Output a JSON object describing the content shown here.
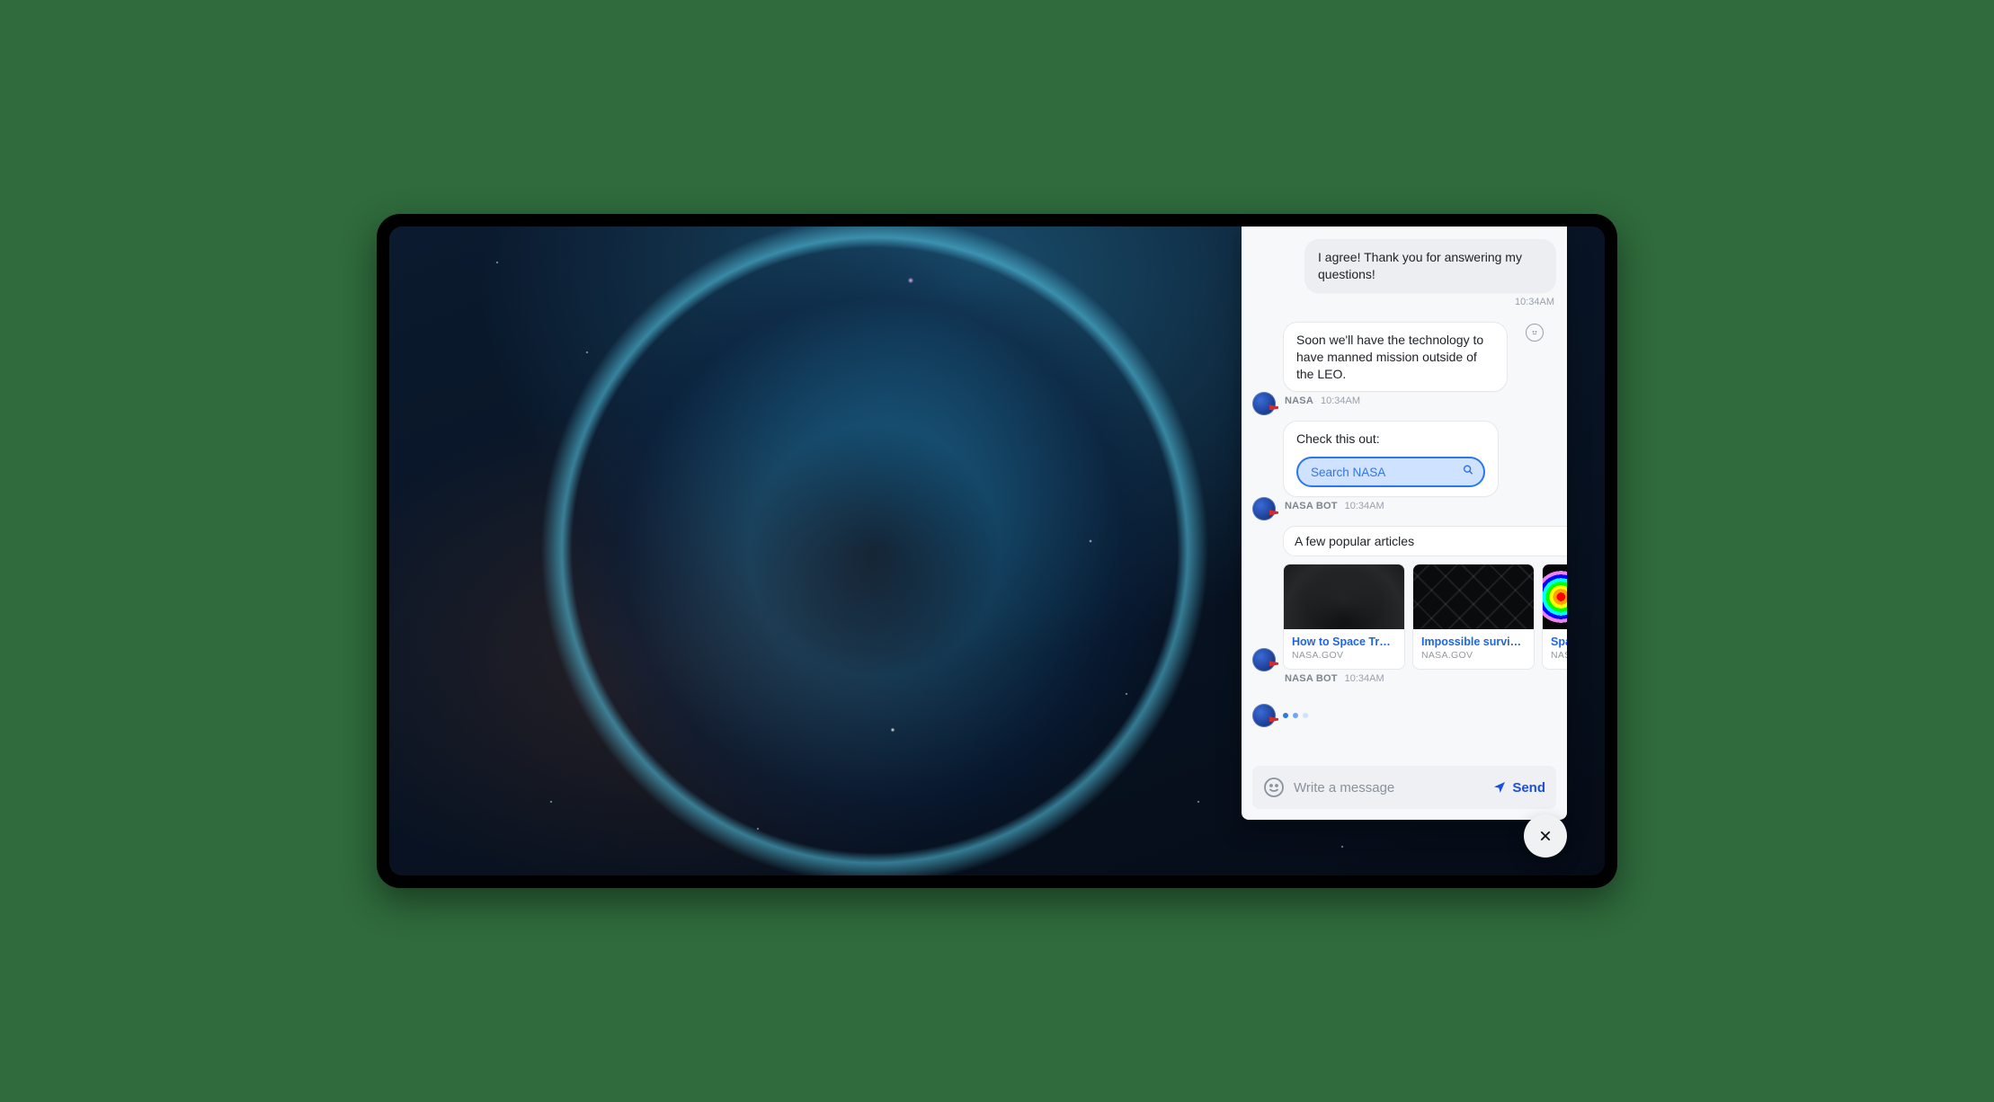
{
  "user_message": {
    "text": "I agree! Thank you for answering my questions!",
    "time": "10:34AM"
  },
  "agent_message": {
    "text": "Soon we'll have the technology to have manned mission outside of the LEO.",
    "sender": "NASA",
    "time": "10:34AM"
  },
  "bot_search": {
    "prompt_text": "Check this out:",
    "search_placeholder": "Search NASA",
    "sender": "NASA BOT",
    "time": "10:34AM"
  },
  "articles": {
    "heading": "A few popular articles",
    "sender": "NASA BOT",
    "time": "10:34AM",
    "cards": [
      {
        "title": "How to Space Travel",
        "source": "NASA.GOV"
      },
      {
        "title": "Impossible survival",
        "source": "NASA.GOV"
      },
      {
        "title": "Spa",
        "source": "NAS"
      }
    ]
  },
  "composer": {
    "placeholder": "Write a message",
    "send_label": "Send"
  }
}
